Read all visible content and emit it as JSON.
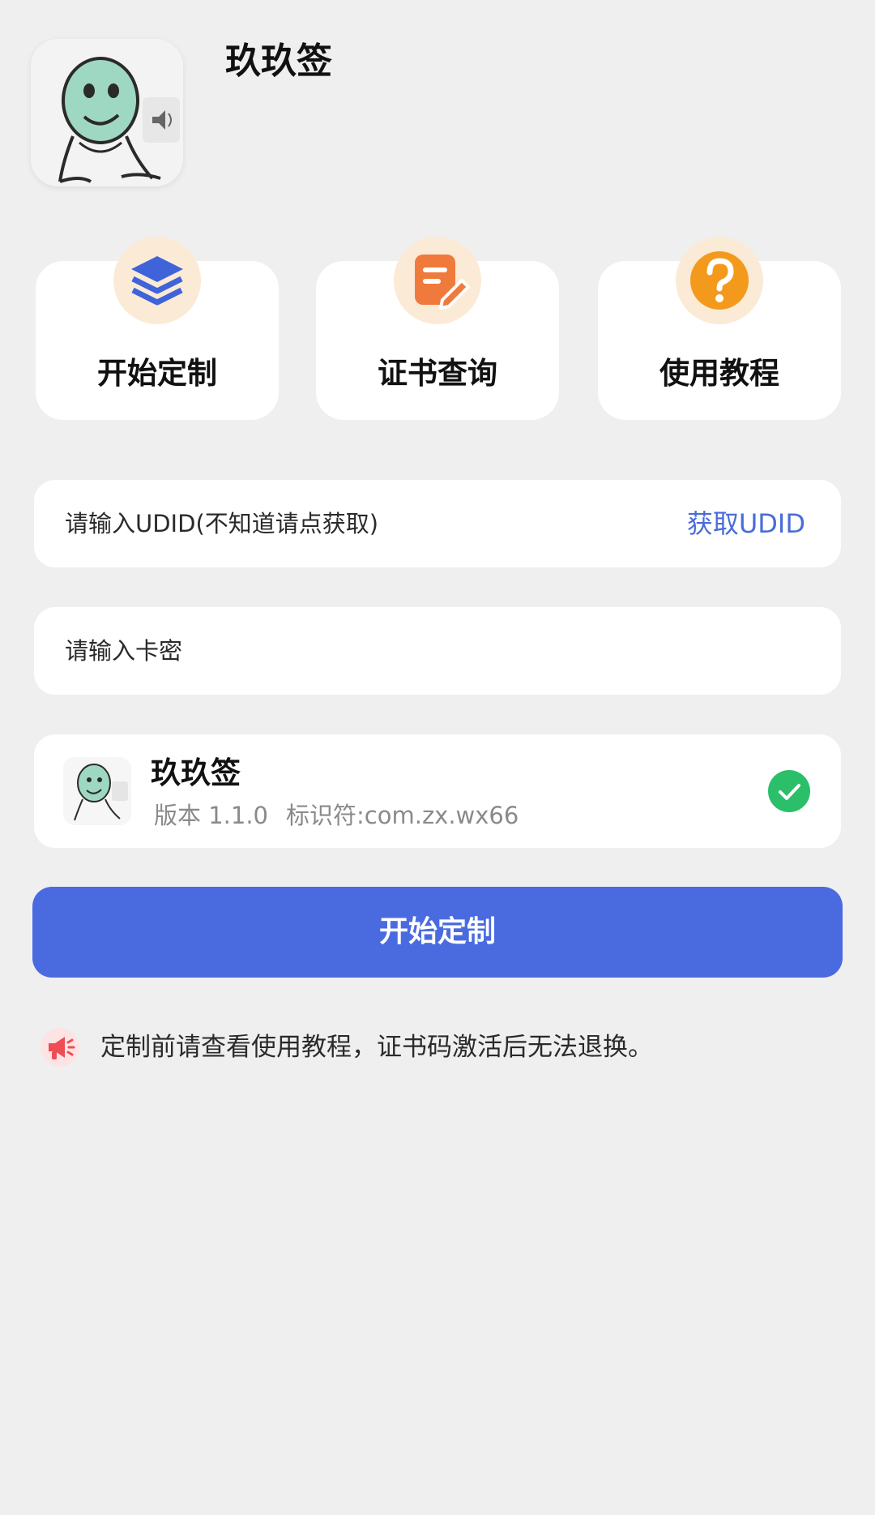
{
  "header": {
    "app_name": "玖玖签",
    "icon": "cartoon-avatar-icon"
  },
  "actions": [
    {
      "label": "开始定制",
      "icon": "layers-icon",
      "color": "#3f63d9"
    },
    {
      "label": "证书查询",
      "icon": "certificate-edit-icon",
      "color": "#f07a3c"
    },
    {
      "label": "使用教程",
      "icon": "question-icon",
      "color": "#f39a1c"
    }
  ],
  "udid_input": {
    "placeholder": "请输入UDID(不知道请点获取)",
    "value": "",
    "action_label": "获取UDID"
  },
  "key_input": {
    "placeholder": "请输入卡密",
    "value": ""
  },
  "app_info": {
    "name": "玖玖签",
    "version": "版本 1.1.0",
    "identifier": "标识符:com.zx.wx66",
    "selected": true,
    "check_color": "#2bbf6a"
  },
  "primary_button": {
    "label": "开始定制",
    "color": "#4a6be0"
  },
  "notice": {
    "icon": "megaphone-icon",
    "text": "定制前请查看使用教程，证书码激活后无法退换。"
  },
  "theme": {
    "background": "#efeff0",
    "link_color": "#4a6cd8"
  }
}
